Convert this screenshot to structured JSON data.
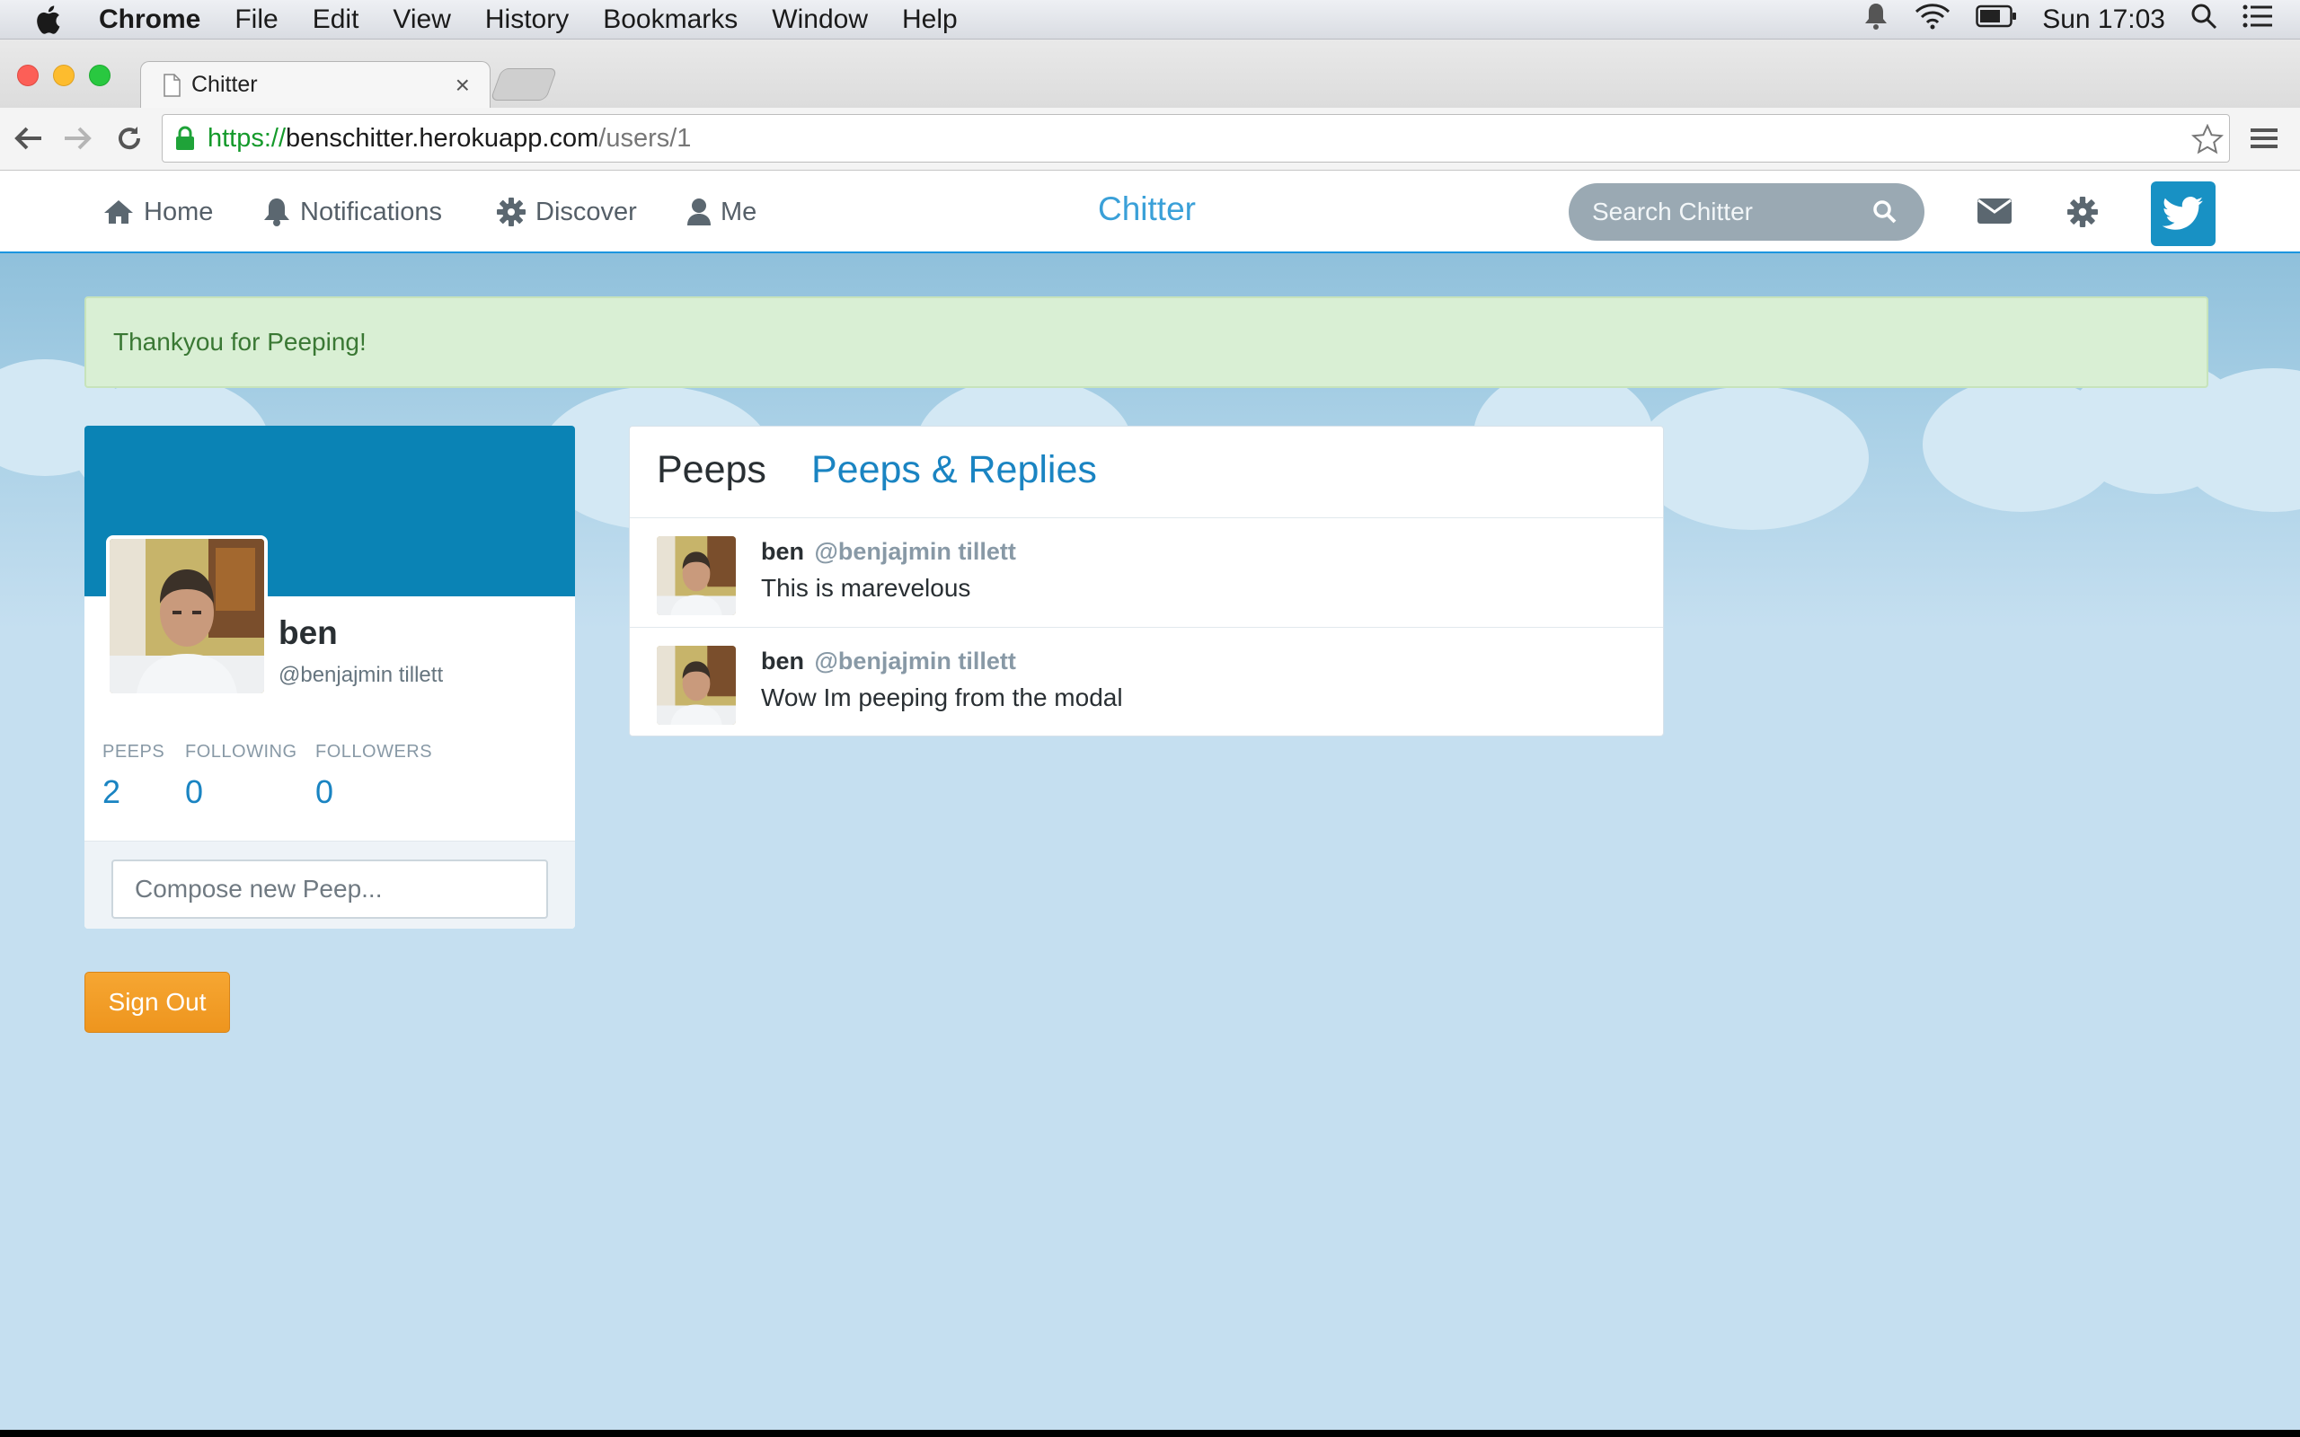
{
  "menubar": {
    "app": "Chrome",
    "items": [
      "File",
      "Edit",
      "View",
      "History",
      "Bookmarks",
      "Window",
      "Help"
    ],
    "clock": "Sun 17:03"
  },
  "browser": {
    "tab_title": "Chitter",
    "tab_close": "×",
    "url_scheme": "https://",
    "url_host": "benschitter.herokuapp.com",
    "url_path": "/users/1"
  },
  "nav": {
    "home": "Home",
    "notifications": "Notifications",
    "discover": "Discover",
    "me": "Me",
    "brand": "Chitter",
    "search_placeholder": "Search Chitter"
  },
  "alert": "Thankyou for Peeping!",
  "profile": {
    "name": "ben",
    "handle": "@benjajmin tillett",
    "stats": [
      {
        "label": "PEEPS",
        "value": "2"
      },
      {
        "label": "FOLLOWING",
        "value": "0"
      },
      {
        "label": "FOLLOWERS",
        "value": "0"
      }
    ],
    "compose_placeholder": "Compose new Peep..."
  },
  "signout": "Sign Out",
  "feed": {
    "tabs": [
      "Peeps",
      "Peeps & Replies"
    ],
    "peeps": [
      {
        "author": "ben",
        "handle": "@benjajmin tillett",
        "text": "This is marevelous"
      },
      {
        "author": "ben",
        "handle": "@benjajmin tillett",
        "text": "Wow Im peeping from the modal"
      }
    ]
  },
  "colors": {
    "accent": "#1a84c2",
    "banner": "#0a83b5",
    "signout": "#f0991f",
    "alert_bg": "#d9efd4",
    "page_bg": "#c5dff0"
  }
}
